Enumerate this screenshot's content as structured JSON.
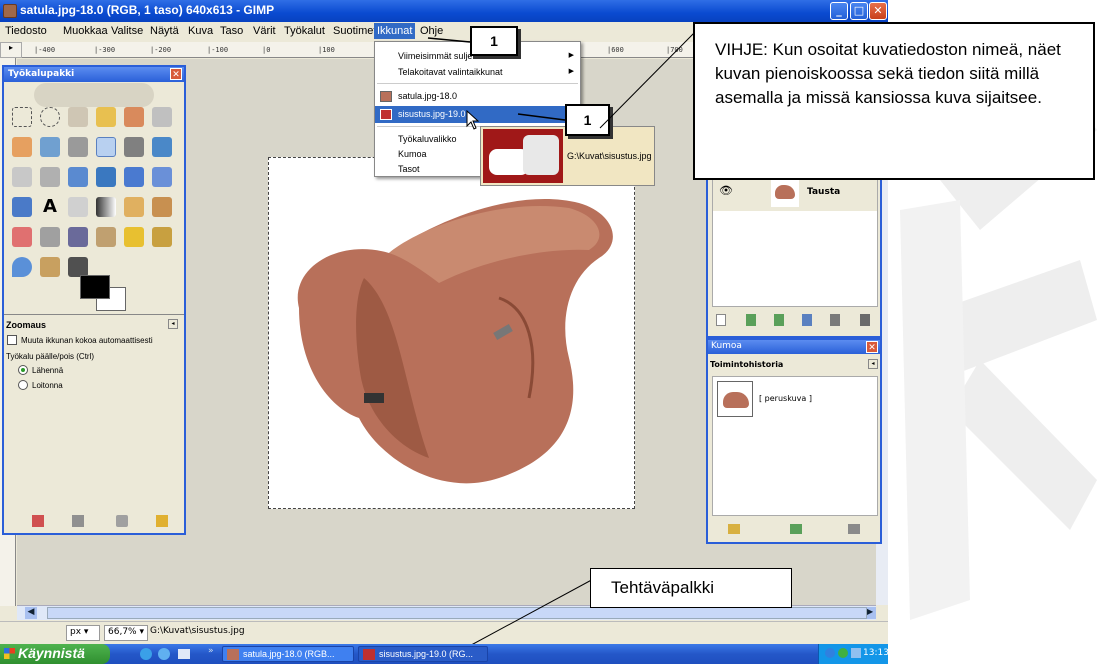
{
  "window": {
    "title": "satula.jpg-18.0 (RGB, 1 taso) 640x613 - GIMP"
  },
  "menubar": {
    "items": [
      "Tiedosto",
      "Muokkaa",
      "Valitse",
      "Näytä",
      "Kuva",
      "Taso",
      "Värit",
      "Työkalut",
      "Suotimet",
      "Ikkunat",
      "Ohje"
    ]
  },
  "ruler": {
    "labels": [
      "|-400",
      "|-300",
      "|-200",
      "|-100",
      "|0",
      "|100",
      "|600",
      "|700"
    ]
  },
  "dropdown": {
    "items": [
      {
        "label": "Viimeisimmät suljetut",
        "submenu": true
      },
      {
        "label": "Telakoitavat valintaikkunat",
        "submenu": true
      },
      {
        "label": "satula.jpg-18.0",
        "submenu": false
      },
      {
        "label": "sisustus.jpg-19.0",
        "submenu": false,
        "highlighted": true
      },
      {
        "label": "Työkaluvalikko",
        "submenu": false
      },
      {
        "label": "Kumoa",
        "submenu": false
      },
      {
        "label": "Tasot",
        "submenu": false
      }
    ]
  },
  "preview": {
    "path": "G:\\Kuvat\\sisustus.jpg"
  },
  "callouts": {
    "menu_marker": "1",
    "item_marker": "1"
  },
  "hint": {
    "text": "VIHJE: Kun osoitat kuvatiedoston nimeä, näet kuvan pienoiskoossa sekä tiedon siitä millä asemalla ja missä kansiossa kuva sijaitsee."
  },
  "taskbar_label": {
    "text": "Tehtäväpalkki"
  },
  "toolbox": {
    "title": "Työkalupakki",
    "options_title": "Zoomaus",
    "resize_checkbox": "Muuta ikkunan kokoa automaattisesti",
    "toggle_label": "Työkalu päälle/pois (Ctrl)",
    "radio_zoom_in": "Lähennä",
    "radio_zoom_out": "Loitonna"
  },
  "layers": {
    "layer_name": "Tausta"
  },
  "undo": {
    "title": "Kumoa",
    "subtitle": "Toimintohistoria",
    "entry": "[ peruskuva ]"
  },
  "statusbar": {
    "unit": "px",
    "zoom": "66,7%",
    "path": "G:\\Kuvat\\sisustus.jpg"
  },
  "taskbar": {
    "start": "Käynnistä",
    "tasks": [
      "satula.jpg-18.0 (RGB...",
      "sisustus.jpg-19.0 (RG..."
    ],
    "clock": "13:13"
  }
}
